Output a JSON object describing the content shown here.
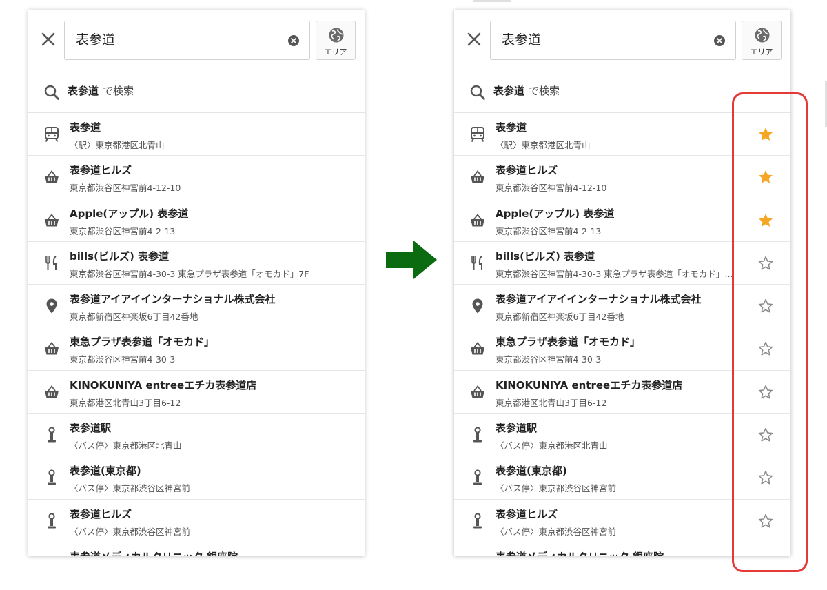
{
  "search": {
    "query": "表参道"
  },
  "area_button": {
    "label": "エリア"
  },
  "search_suggestion": {
    "keyword": "表参道",
    "suffix": "で検索"
  },
  "colors": {
    "star_on": "#f5a623",
    "star_off": "#8a8a8a",
    "highlight": "#e53935",
    "arrow": "#0a6b11"
  },
  "results": [
    {
      "icon": "train-icon",
      "name": "表参道",
      "addr": "〈駅〉東京都港区北青山",
      "favorite": true
    },
    {
      "icon": "shop-basket-icon",
      "name": "表参道ヒルズ",
      "addr": "東京都渋谷区神宮前4-12-10",
      "favorite": true
    },
    {
      "icon": "shop-basket-icon",
      "name": "Apple(アップル) 表参道",
      "addr": "東京都渋谷区神宮前4-2-13",
      "favorite": true
    },
    {
      "icon": "restaurant-icon",
      "name": "bills(ビルズ) 表参道",
      "addr": "東京都渋谷区神宮前4-30-3 東急プラザ表参道「オモカド」7F",
      "favorite": false
    },
    {
      "icon": "location-pin-icon",
      "name": "表参道アイアイインターナショナル株式会社",
      "addr": "東京都新宿区神楽坂6丁目42番地",
      "favorite": false
    },
    {
      "icon": "shop-basket-icon",
      "name": "東急プラザ表参道「オモカド」",
      "addr": "東京都渋谷区神宮前4-30-3",
      "favorite": false
    },
    {
      "icon": "shop-basket-icon",
      "name": "KINOKUNIYA entreeエチカ表参道店",
      "addr": "東京都港区北青山3丁目6-12",
      "favorite": false
    },
    {
      "icon": "bus-stop-icon",
      "name": "表参道駅",
      "addr": "〈バス停〉東京都港区北青山",
      "favorite": false
    },
    {
      "icon": "bus-stop-icon",
      "name": "表参道(東京都)",
      "addr": "〈バス停〉東京都渋谷区神宮前",
      "favorite": false
    },
    {
      "icon": "bus-stop-icon",
      "name": "表参道ヒルズ",
      "addr": "〈バス停〉東京都渋谷区神宮前",
      "favorite": false
    },
    {
      "icon": "location-pin-icon",
      "name": "表参道メディカルクリニック 銀座院",
      "addr": "",
      "favorite": false
    }
  ]
}
